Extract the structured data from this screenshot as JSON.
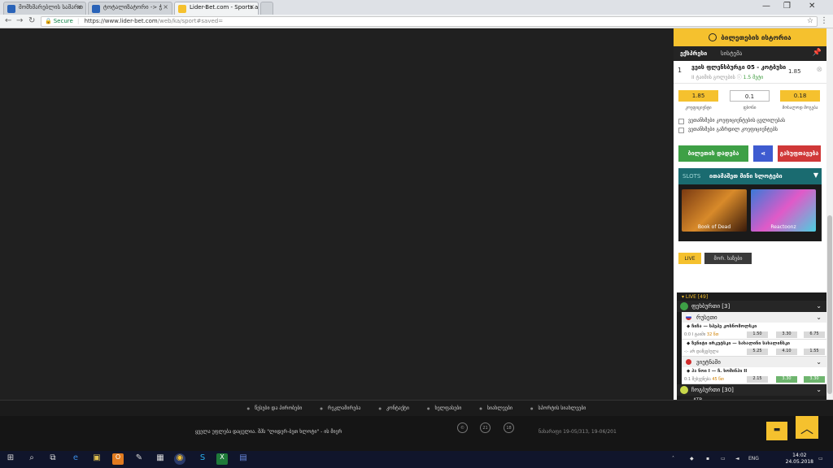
{
  "browser": {
    "tabs": [
      {
        "title": "მომხმარებლის სამართ",
        "icon": "chrome-page-icon"
      },
      {
        "title": "ტოტალიზატორი -> ჭ",
        "icon": "chrome-page-icon"
      },
      {
        "title": "Lider-Bet.com - Sports a",
        "icon": "liderbet-favicon"
      }
    ],
    "address": {
      "secure_label": "Secure",
      "url_host": "https://www.lider-bet.com",
      "url_path": "/web/ka/sport#saved="
    }
  },
  "betslip": {
    "history_title": "ბილეთების ისტორია",
    "tab_single": "ექსპრესი",
    "tab_system": "სისტემა",
    "bet": {
      "number": "1",
      "event": "ვეის ფლენსბურგი 05 - კოტბუსი",
      "market": "II ტაიმის გოლების",
      "pick": "1.5 მეტი",
      "odd": "1.85"
    },
    "coef_value": "1.85",
    "stake_value": "0.1",
    "win_value": "0.18",
    "coef_label": "კოეფიციენტი",
    "stake_label": "ფსონი",
    "win_label": "მოსალოდ მოგება",
    "check1": "ვეთანხმები კოეფიციენტების ცვლილებას",
    "check2": "ვეთანხმები გაზრდილ კოეფიციენტებს",
    "place_bet": "ბილეთის დადება",
    "clear": "გასუფთავება"
  },
  "slots": {
    "label": "SLOTS",
    "title": "ითამაშეთ მინი სლოტები",
    "games": [
      {
        "name": "Book of Dead"
      },
      {
        "name": "Reactoonz"
      }
    ]
  },
  "live": {
    "tab_live": "LIVE",
    "tab_other": "მორ. ხაზები",
    "header": "LIVE [49]",
    "football": "ფეხბურთი [3]",
    "russia": "რუსეთი",
    "m1_teams": "ჩიჩა — სპეპე კოსნომოლსკი",
    "m1_info": "0:0 I ტაიმი",
    "m1_min": "32 წთ",
    "m1_odds": [
      "1.50",
      "3.30",
      "6.75"
    ],
    "m2_teams": "ზენიტი ირკუტსკი — სახალინი სახალინსკი",
    "m2_info": "-:- არ დაწყებულა",
    "m2_odds": [
      "5.25",
      "4.10",
      "1.55"
    ],
    "vietnam": "ვიეტნამი",
    "m3_teams": "ჰა ნოი I — ჩ. ხოშინჰი II",
    "m3_info": "0:1 შესვენება",
    "m3_min": "45 წთ",
    "m3_odds": [
      "2.15",
      "3.30",
      "3.30"
    ],
    "tennis": "ჩოგბურთი [30]",
    "atp": "ATP"
  },
  "footer": {
    "links": [
      "წესები და პირობები",
      "რეკლამირება",
      "კონტაქტი",
      "ხელფასები",
      "სიახლეები",
      "სპორტის სიახლეები"
    ],
    "copyright": "ყველა უფლება დაცულია. შპს \"ლიდერ-ბეთ ხლოტი\" - ის მიერ",
    "badge_c": "©",
    "badge_21": "21",
    "badge_18": "18",
    "version": "ნახარაფი 19-05/313, 19-06/201"
  },
  "taskbar": {
    "time": "14:02",
    "date": "24.05.2018"
  },
  "colors": {
    "accent": "#f5c12e",
    "green": "#3ea046",
    "blue": "#3e5bd0",
    "red": "#d03838",
    "teal": "#1a6b70"
  }
}
